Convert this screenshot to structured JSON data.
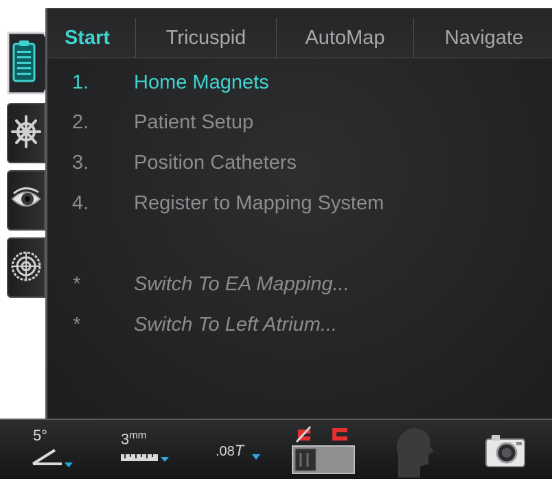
{
  "tabs": [
    {
      "label": "Start",
      "active": true
    },
    {
      "label": "Tricuspid",
      "active": false
    },
    {
      "label": "AutoMap",
      "active": false
    },
    {
      "label": "Navigate",
      "active": false
    }
  ],
  "steps": [
    {
      "num": "1.",
      "label": "Home Magnets",
      "active": true
    },
    {
      "num": "2.",
      "label": "Patient Setup",
      "active": false
    },
    {
      "num": "3.",
      "label": "Position Catheters",
      "active": false
    },
    {
      "num": "4.",
      "label": "Register to Mapping System",
      "active": false
    }
  ],
  "links": [
    {
      "bullet": "*",
      "label": "Switch To EA Mapping..."
    },
    {
      "bullet": "*",
      "label": "Switch To Left Atrium..."
    }
  ],
  "sidebar": {
    "icons": [
      "clipboard-icon",
      "helm-icon",
      "eye-icon",
      "target-icon"
    ]
  },
  "toolbar": {
    "angle_value": "5°",
    "step_value": "3",
    "step_unit": "mm",
    "field_value": ".08",
    "field_unit": "T",
    "icons": [
      "angle-icon",
      "ruler-icon",
      "magnet-field-icon",
      "magnet-toggle-icon",
      "patient-head-icon",
      "camera-icon"
    ]
  },
  "colors": {
    "accent": "#3fd3d0",
    "text_dim": "#8b8c8e",
    "panel_bg": "#232426",
    "magnet_red": "#e2312f"
  }
}
